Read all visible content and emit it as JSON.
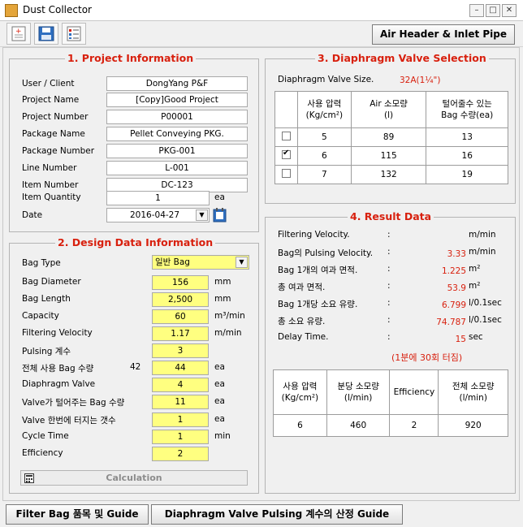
{
  "window": {
    "title": "Dust Collector"
  },
  "toolbar": {
    "air_header_button": "Air Header & Inlet Pipe"
  },
  "project": {
    "title": "1. Project Information",
    "fields": [
      {
        "label": "User / Client",
        "value": "DongYang P&F"
      },
      {
        "label": "Project Name",
        "value": "[Copy]Good Project"
      },
      {
        "label": "Project Number",
        "value": "P00001"
      },
      {
        "label": "Package Name",
        "value": "Pellet Conveying PKG."
      },
      {
        "label": "Package Number",
        "value": "PKG-001"
      },
      {
        "label": "Line Number",
        "value": "L-001"
      },
      {
        "label": "Item Number",
        "value": "DC-123"
      }
    ],
    "quantity": {
      "label": "Item Quantity",
      "value": "1",
      "unit": "ea"
    },
    "date": {
      "label": "Date",
      "value": "2016-04-27"
    }
  },
  "design": {
    "title": "2. Design Data Information",
    "bag_type": {
      "label": "Bag Type",
      "value": "일반 Bag"
    },
    "rows": [
      {
        "label": "Bag Diameter",
        "value": "156",
        "unit": "mm"
      },
      {
        "label": "Bag Length",
        "value": "2,500",
        "unit": "mm"
      },
      {
        "label": "Capacity",
        "value": "60",
        "unit": "m³/min"
      },
      {
        "label": "Filtering Velocity",
        "value": "1.17",
        "unit": "m/min"
      },
      {
        "label": "Pulsing 계수",
        "value": "3",
        "unit": ""
      },
      {
        "label": "전체 사용 Bag 수량",
        "value": "44",
        "unit": "ea",
        "extra": "42"
      },
      {
        "label": "Diaphragm Valve",
        "value": "4",
        "unit": "ea"
      },
      {
        "label": "Valve가 털어주는 Bag 수량",
        "value": "11",
        "unit": "ea"
      },
      {
        "label": "Valve 한번에 터지는 갯수",
        "value": "1",
        "unit": "ea"
      },
      {
        "label": "Cycle Time",
        "value": "1",
        "unit": "min"
      },
      {
        "label": "Efficiency",
        "value": "2",
        "unit": ""
      }
    ],
    "calc_button": "Calculation"
  },
  "diaphragm": {
    "title": "3. Diaphragm Valve Selection",
    "size_label": "Diaphragm Valve Size.",
    "size_value": "32A(1¼\")",
    "headers": [
      "사용 압력\n(Kg/cm²)",
      "Air 소모량\n(l)",
      "털어줄수 있는\nBag 수량(ea)"
    ],
    "rows": [
      {
        "checked": false,
        "pressure": "5",
        "air": "89",
        "bags": "13"
      },
      {
        "checked": true,
        "pressure": "6",
        "air": "115",
        "bags": "16"
      },
      {
        "checked": false,
        "pressure": "7",
        "air": "132",
        "bags": "19"
      }
    ]
  },
  "result": {
    "title": "4. Result Data",
    "rows": [
      {
        "label": "Filtering Velocity.",
        "sep": ":",
        "value": "",
        "unit": "m/min"
      },
      {
        "label": "Bag의 Pulsing Velocity.",
        "sep": ":",
        "value": "3.33",
        "unit": "m/min"
      },
      {
        "label": "Bag 1개의 여과 면적.",
        "sep": ":",
        "value": "1.225",
        "unit": "m²"
      },
      {
        "label": "총 여과 면적.",
        "sep": ":",
        "value": "53.9",
        "unit": "m²"
      },
      {
        "label": "Bag 1개당 소요 유량.",
        "sep": ":",
        "value": "6.799",
        "unit": "l/0.1sec"
      },
      {
        "label": "총 소요 유량.",
        "sep": ":",
        "value": "74.787",
        "unit": "l/0.1sec"
      },
      {
        "label": "Delay Time.",
        "sep": ":",
        "value": "15",
        "unit": "sec"
      }
    ],
    "note": "(1분에 30회 터짐)",
    "table_headers": [
      "사용 압력\n(Kg/cm²)",
      "분당 소모량\n(l/min)",
      "Efficiency",
      "전체 소모량\n(l/min)"
    ],
    "table_row": [
      "6",
      "460",
      "2",
      "920"
    ]
  },
  "bottom": {
    "filter_bag_button": "Filter Bag 품목 및 Guide",
    "pulsing_button": "Diaphragm Valve Pulsing 계수의 산정 Guide"
  }
}
